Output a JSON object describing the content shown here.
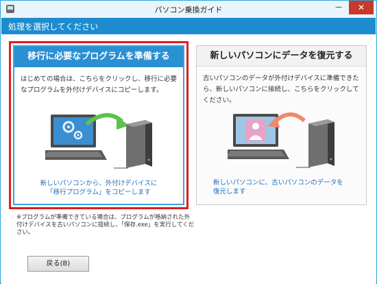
{
  "window": {
    "title": "パソコン乗換ガイド",
    "minimize_label": "－",
    "close_label": "✕"
  },
  "header": {
    "text": "処理を選択してください"
  },
  "options": [
    {
      "title": "移行に必要なプログラムを準備する",
      "description": "はじめての場合は、こちらをクリックし、移行に必要なプログラムを外付けデバイスにコピーします。",
      "caption_line1": "新しいパソコンから、外付けデバイスに",
      "caption_line2": "「移行プログラム」をコピーします",
      "selected": true
    },
    {
      "title": "新しいパソコンにデータを復元する",
      "description": "古いパソコンのデータが外付けデバイスに準備できたら、新しいパソコンに接続し、こちらをクリックしてください。",
      "caption_line1": "新しいパソコンに、古いパソコンのデータを",
      "caption_line2": "復元します",
      "selected": false
    }
  ],
  "note": "※プログラムが準備できている場合は、プログラムが格納された外付けデバイスを古いパソコンに接続し、「保存.exe」を実行してください。",
  "buttons": {
    "back": "戻る(B)"
  },
  "colors": {
    "accent": "#1d8ccf",
    "selected_border": "#e11c1c",
    "caption": "#1d6fb8",
    "arrow_left": "#5cc24a",
    "arrow_right": "#f08a6c"
  },
  "icons": {
    "left_illustration": "laptop-gear-to-drive",
    "right_illustration": "drive-to-laptop-person"
  }
}
